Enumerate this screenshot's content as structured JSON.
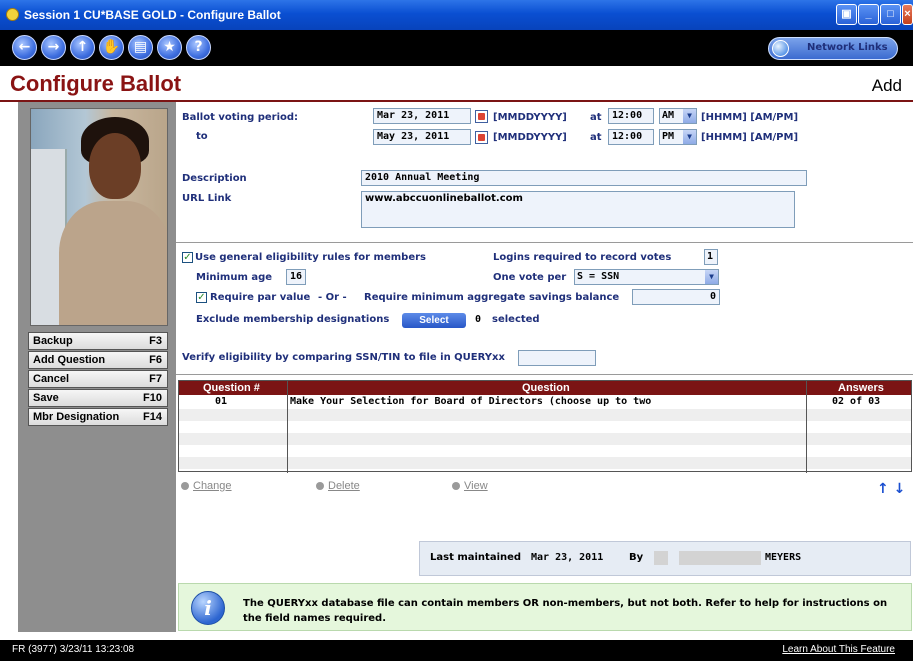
{
  "window": {
    "title": "Session 1 CU*BASE GOLD - Configure Ballot"
  },
  "nav": {
    "network_links": "Network Links"
  },
  "header": {
    "title": "Configure Ballot",
    "mode": "Add"
  },
  "fkeys": [
    {
      "label": "Backup",
      "key": "F3"
    },
    {
      "label": "Add Question",
      "key": "F6"
    },
    {
      "label": "Cancel",
      "key": "F7"
    },
    {
      "label": "Save",
      "key": "F10"
    },
    {
      "label": "Mbr Designation",
      "key": "F14"
    }
  ],
  "period": {
    "label": "Ballot voting period:",
    "to_label": "to",
    "start_date": "Mar 23, 2011",
    "end_date": "May 23, 2011",
    "date_format": "[MMDDYYYY]",
    "at_label": "at",
    "start_time": "12:00",
    "end_time": "12:00",
    "start_ampm": "AM",
    "end_ampm": "PM",
    "time_format": "[HHMM] [AM/PM]"
  },
  "description": {
    "label": "Description",
    "value": "2010 Annual Meeting"
  },
  "url": {
    "label": "URL Link",
    "value": "www.abccuonlineballot.com"
  },
  "eligibility": {
    "general_rules_label": "Use general eligibility rules for members",
    "general_rules_checked": true,
    "logins_label": "Logins required to record votes",
    "logins_value": "1",
    "min_age_label": "Minimum age",
    "min_age_value": "16",
    "one_vote_label": "One vote per",
    "one_vote_value": "S = SSN",
    "par_value_label": "Require par value",
    "par_value_checked": true,
    "or_label": "- Or -",
    "min_agg_label": "Require minimum aggregate savings balance",
    "min_agg_value": "0",
    "exclude_label": "Exclude membership designations",
    "select_button": "Select",
    "selected_count": "0",
    "selected_label": "selected",
    "verify_label": "Verify eligibility by comparing SSN/TIN to file in QUERYxx",
    "verify_value": ""
  },
  "questions": {
    "headers": [
      "Question #",
      "Question",
      "Answers"
    ],
    "rows": [
      {
        "num": "01",
        "question": "Make Your Selection for Board of Directors (choose up to two",
        "answers": "02 of 03"
      }
    ]
  },
  "actions": {
    "change": "Change",
    "delete": "Delete",
    "view": "View"
  },
  "maintained": {
    "label": "Last maintained",
    "date": "Mar 23, 2011",
    "by_label": "By",
    "user": "MEYERS"
  },
  "info": {
    "text": "The QUERYxx database file can contain members OR non-members, but not both.  Refer to help for instructions on the field names required."
  },
  "status": {
    "left": "FR (3977) 3/23/11 13:23:08",
    "right": "Learn About This Feature"
  }
}
